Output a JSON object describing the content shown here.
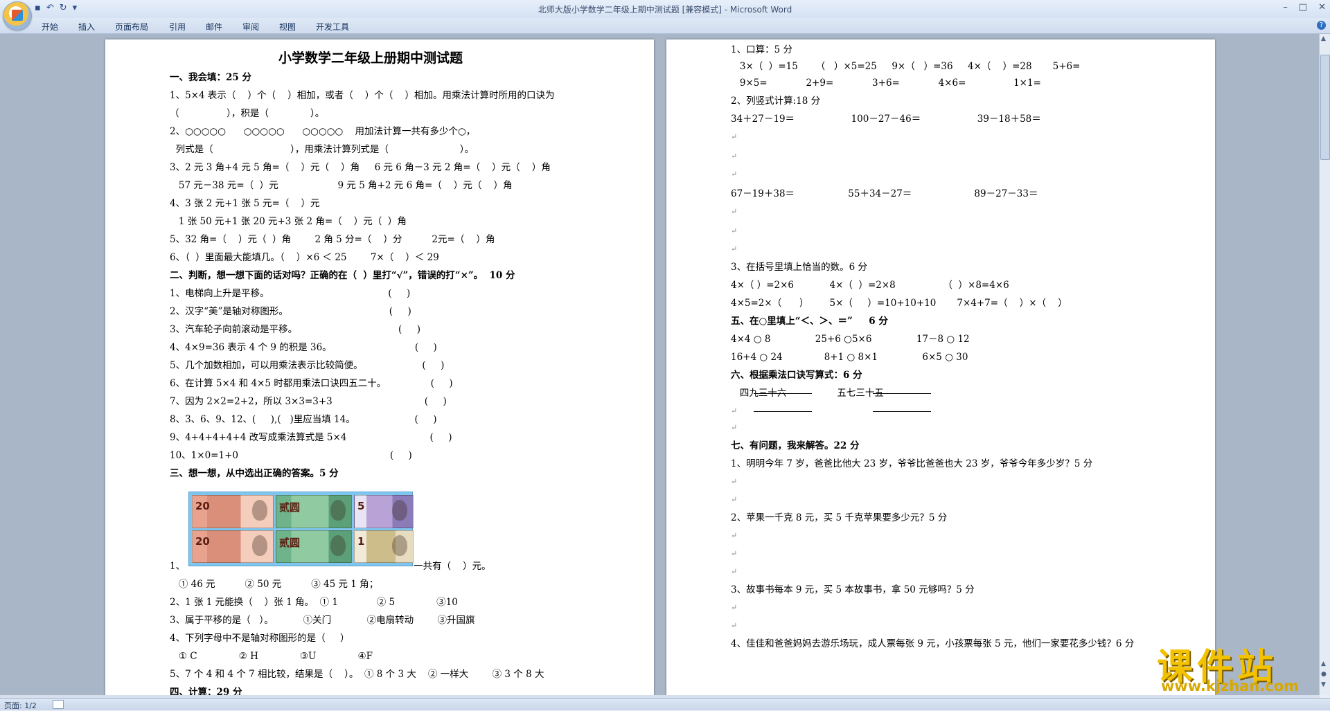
{
  "window": {
    "title": "北师大版小学数学二年级上期中测试题 [兼容模式] - Microsoft Word",
    "controls": [
      "–",
      "□",
      "✕"
    ]
  },
  "qat": {
    "save_icon": "save-icon",
    "undo_icon": "undo-icon",
    "redo_icon": "redo-icon"
  },
  "ribbon_tabs": [
    "开始",
    "插入",
    "页面布局",
    "引用",
    "邮件",
    "审阅",
    "视图",
    "开发工具"
  ],
  "help": "?",
  "status": {
    "page": "页面: 1/2"
  },
  "watermark": {
    "text": "课件站",
    "url": "www.kjzhan.com"
  },
  "money_image": {
    "notes": [
      "20",
      "贰圆",
      "5",
      "20",
      "贰圆",
      "1"
    ]
  },
  "left_page": [
    {
      "text": "小学数学二年级上册期中测试题",
      "style": "title"
    },
    {
      "text": "一、我会填：25 分",
      "style": "bold"
    },
    {
      "text": "1、5×4 表示（    ）个（    ）相加，或者（    ）个（    ）相加。用乘法计算时所用的口诀为"
    },
    {
      "text": "（                ），积是（              ）。"
    },
    {
      "text": "2、○○○○○      ○○○○○      ○○○○○    用加法计算一共有多少个○，"
    },
    {
      "text": "  列式是（                          ），用乘法计算列式是（                        ）。"
    },
    {
      "text": "3、2 元 3 角+4 元 5 角=（    ）元（    ）角     6 元 6 角－3 元 2 角=（    ）元（    ）角"
    },
    {
      "text": "   57 元－38 元=（  ）元                    9 元 5 角+2 元 6 角=（    ）元（    ）角"
    },
    {
      "text": "4、3 张 2 元+1 张 5 元=（    ）元"
    },
    {
      "text": "   1 张 50 元+1 张 20 元+3 张 2 角=（    ）元（  ）角"
    },
    {
      "text": "5、32 角=（    ）元（  ）角        2 角 5 分=（    ）分          2元=（    ）角"
    },
    {
      "text": "6、（  ）里面最大能填几。（    ）×6 ＜ 25        7×（    ）＜ 29"
    },
    {
      "text": "二、判断，想一想下面的话对吗？正确的在（  ）里打“√”，错误的打“×”。  10 分",
      "style": "bold"
    },
    {
      "text": "1、电梯向上升是平移。                                        (     )"
    },
    {
      "text": "2、汉字“美”是轴对称图形。                                  (     )"
    },
    {
      "text": "3、汽车轮子向前滚动是平移。                                  (     )"
    },
    {
      "text": "4、4×9=36 表示 4 个 9 的积是 36。                            (     )"
    },
    {
      "text": "5、几个加数相加，可以用乘法表示比较简便。                    (     )"
    },
    {
      "text": "6、在计算 5×4 和 4×5 时都用乘法口诀四五二十。               (     )"
    },
    {
      "text": "7、因为 2×2=2+2，所以 3×3=3+3                               (     )"
    },
    {
      "text": "8、3、6、9、12、(     ),(   )里应当填 14。                    (     )"
    },
    {
      "text": "9、4+4+4+4+4 改写成乘法算式是 5×4                            (     )"
    },
    {
      "text": "10、1×0=1+0                                                   (     )"
    },
    {
      "text": "三、想一想，从中选出正确的答案。5 分",
      "style": "bold"
    },
    {
      "text": "1、"
    },
    {
      "text": "一共有（    ）元。"
    },
    {
      "text": "   ① 46 元          ② 50 元          ③ 45 元 1 角；"
    },
    {
      "text": "2、1 张 1 元能换（    ）张 1 角。  ① 1             ② 5              ③10"
    },
    {
      "text": "3、属于平移的是（   ）。          ①关门            ②电扇转动        ③升国旗"
    },
    {
      "text": "4、下列字母中不是轴对称图形的是（     ）"
    },
    {
      "text": "   ① C              ② H              ③U              ④F"
    },
    {
      "text": "5、7 个 4 和 4 个 7 相比较，结果是（    ）。  ① 8 个 3 大    ② 一样大        ③ 3 个 8 大"
    },
    {
      "text": "四、计算：29 分",
      "style": "bold"
    }
  ],
  "right_page": [
    {
      "text": "1、口算：5 分"
    },
    {
      "text": "   3×（  ）=15      （   ）×5=25     9×（   ）=36     4×（    ）=28       5+6="
    },
    {
      "text": "   9×5=             2+9=             3+6=             4×6=                1×1="
    },
    {
      "text": "2、列竖式计算:18 分"
    },
    {
      "text": "34＋27－19＝                   100－27－46＝                   39－18＋58＝"
    },
    {
      "text": ""
    },
    {
      "text": ""
    },
    {
      "text": ""
    },
    {
      "text": "67－19＋38＝                  55＋34－27＝                     89－27－33＝"
    },
    {
      "text": ""
    },
    {
      "text": ""
    },
    {
      "text": ""
    },
    {
      "text": "3、在括号里填上恰当的数。6 分"
    },
    {
      "text": "4×（ ）=2×6            4×（  ）=2×8                （  ）×8=4×6"
    },
    {
      "text": "4×5=2×（      ）       5×（     ）=10+10+10       7×4+7=（    ）×（    ）"
    },
    {
      "text": "五、在○里填上“＜、＞、＝”     6 分",
      "style": "bold"
    },
    {
      "text": "4×4 ○ 8               25+6 ○5×6               17－8 ○ 12"
    },
    {
      "text": "16+4 ○ 24              8+1 ○ 8×1               6×5 ○ 30"
    },
    {
      "text": "六、根据乘法口诀写算式：6 分",
      "style": "bold"
    },
    {
      "text": "   四九三十六                 五七三十五"
    },
    {
      "text": ""
    },
    {
      "text": ""
    },
    {
      "text": "七、有问题，我来解答。22 分",
      "style": "bold"
    },
    {
      "text": "1、明明今年 7 岁，爸爸比他大 23 岁，爷爷比爸爸也大 23 岁，爷爷今年多少岁？5 分"
    },
    {
      "text": ""
    },
    {
      "text": ""
    },
    {
      "text": "2、苹果一千克 8 元，买 5 千克苹果要多少元？5 分"
    },
    {
      "text": ""
    },
    {
      "text": ""
    },
    {
      "text": ""
    },
    {
      "text": "3、故事书每本 9 元，买 5 本故事书，拿 50 元够吗？5 分"
    },
    {
      "text": ""
    },
    {
      "text": ""
    },
    {
      "text": "4、佳佳和爸爸妈妈去游乐场玩，成人票每张 9 元，小孩票每张 5 元，他们一家要花多少钱？6 分"
    }
  ]
}
